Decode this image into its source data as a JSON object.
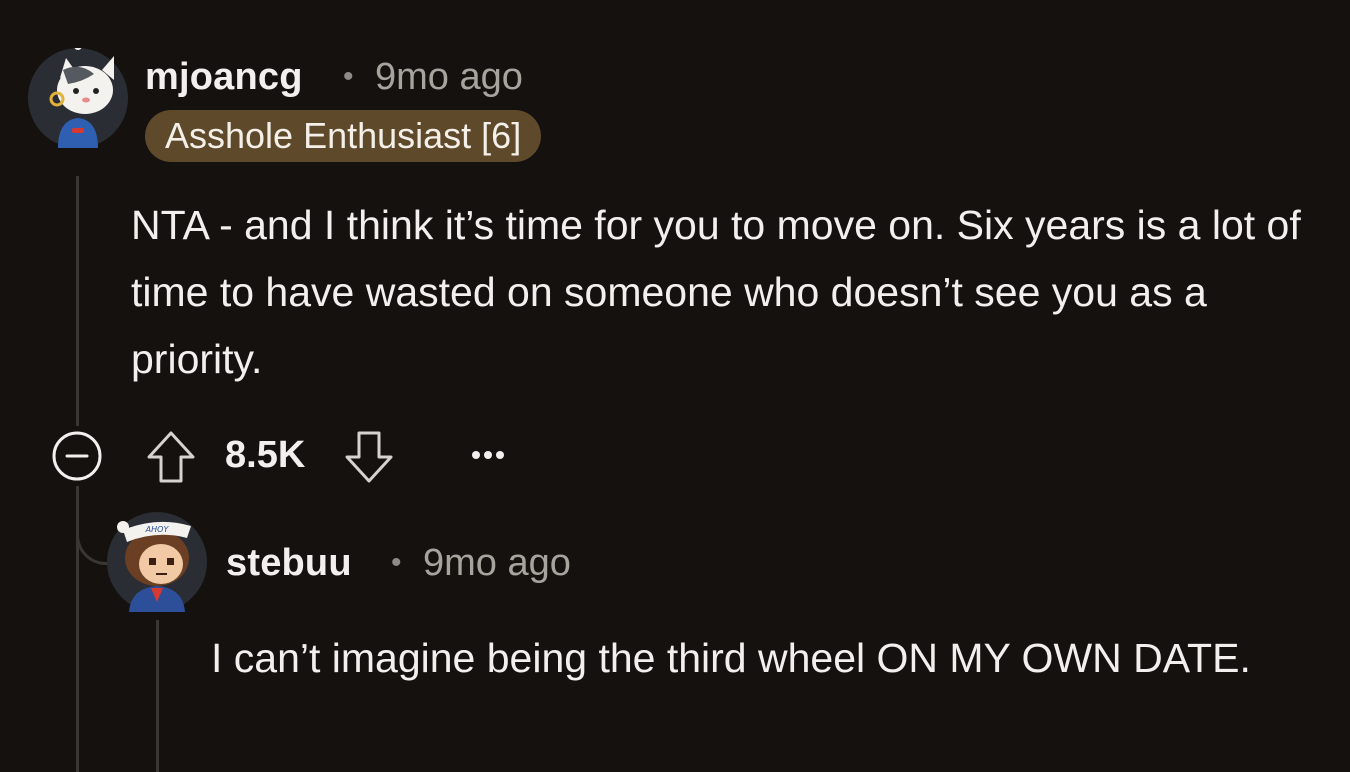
{
  "comment": {
    "username": "mjoancg",
    "separator": "•",
    "time": "9mo ago",
    "flair": "Asshole Enthusiast [6]",
    "body": "NTA - and I think it’s time for you to move on. Six years is a lot of time to have wasted on someone who doesn’t see you as a priority.",
    "votes": "8.5K",
    "avatar_icon": "cat-avatar-icon"
  },
  "reply": {
    "username": "stebuu",
    "separator": "•",
    "time": "9mo ago",
    "body": "I can’t imagine being the third wheel ON MY OWN DATE.",
    "hat_text": "AHOY",
    "avatar_icon": "sailor-avatar-icon"
  },
  "actions": {
    "collapse_icon": "collapse-minus-icon",
    "upvote_icon": "upvote-arrow-icon",
    "downvote_icon": "downvote-arrow-icon",
    "more_icon": "more-ellipsis-icon",
    "more_label": "•••"
  },
  "colors": {
    "background": "#15110e",
    "flair_bg": "#5e4a2a",
    "thread_line": "#3a3633",
    "meta_text": "#a9a39e"
  }
}
